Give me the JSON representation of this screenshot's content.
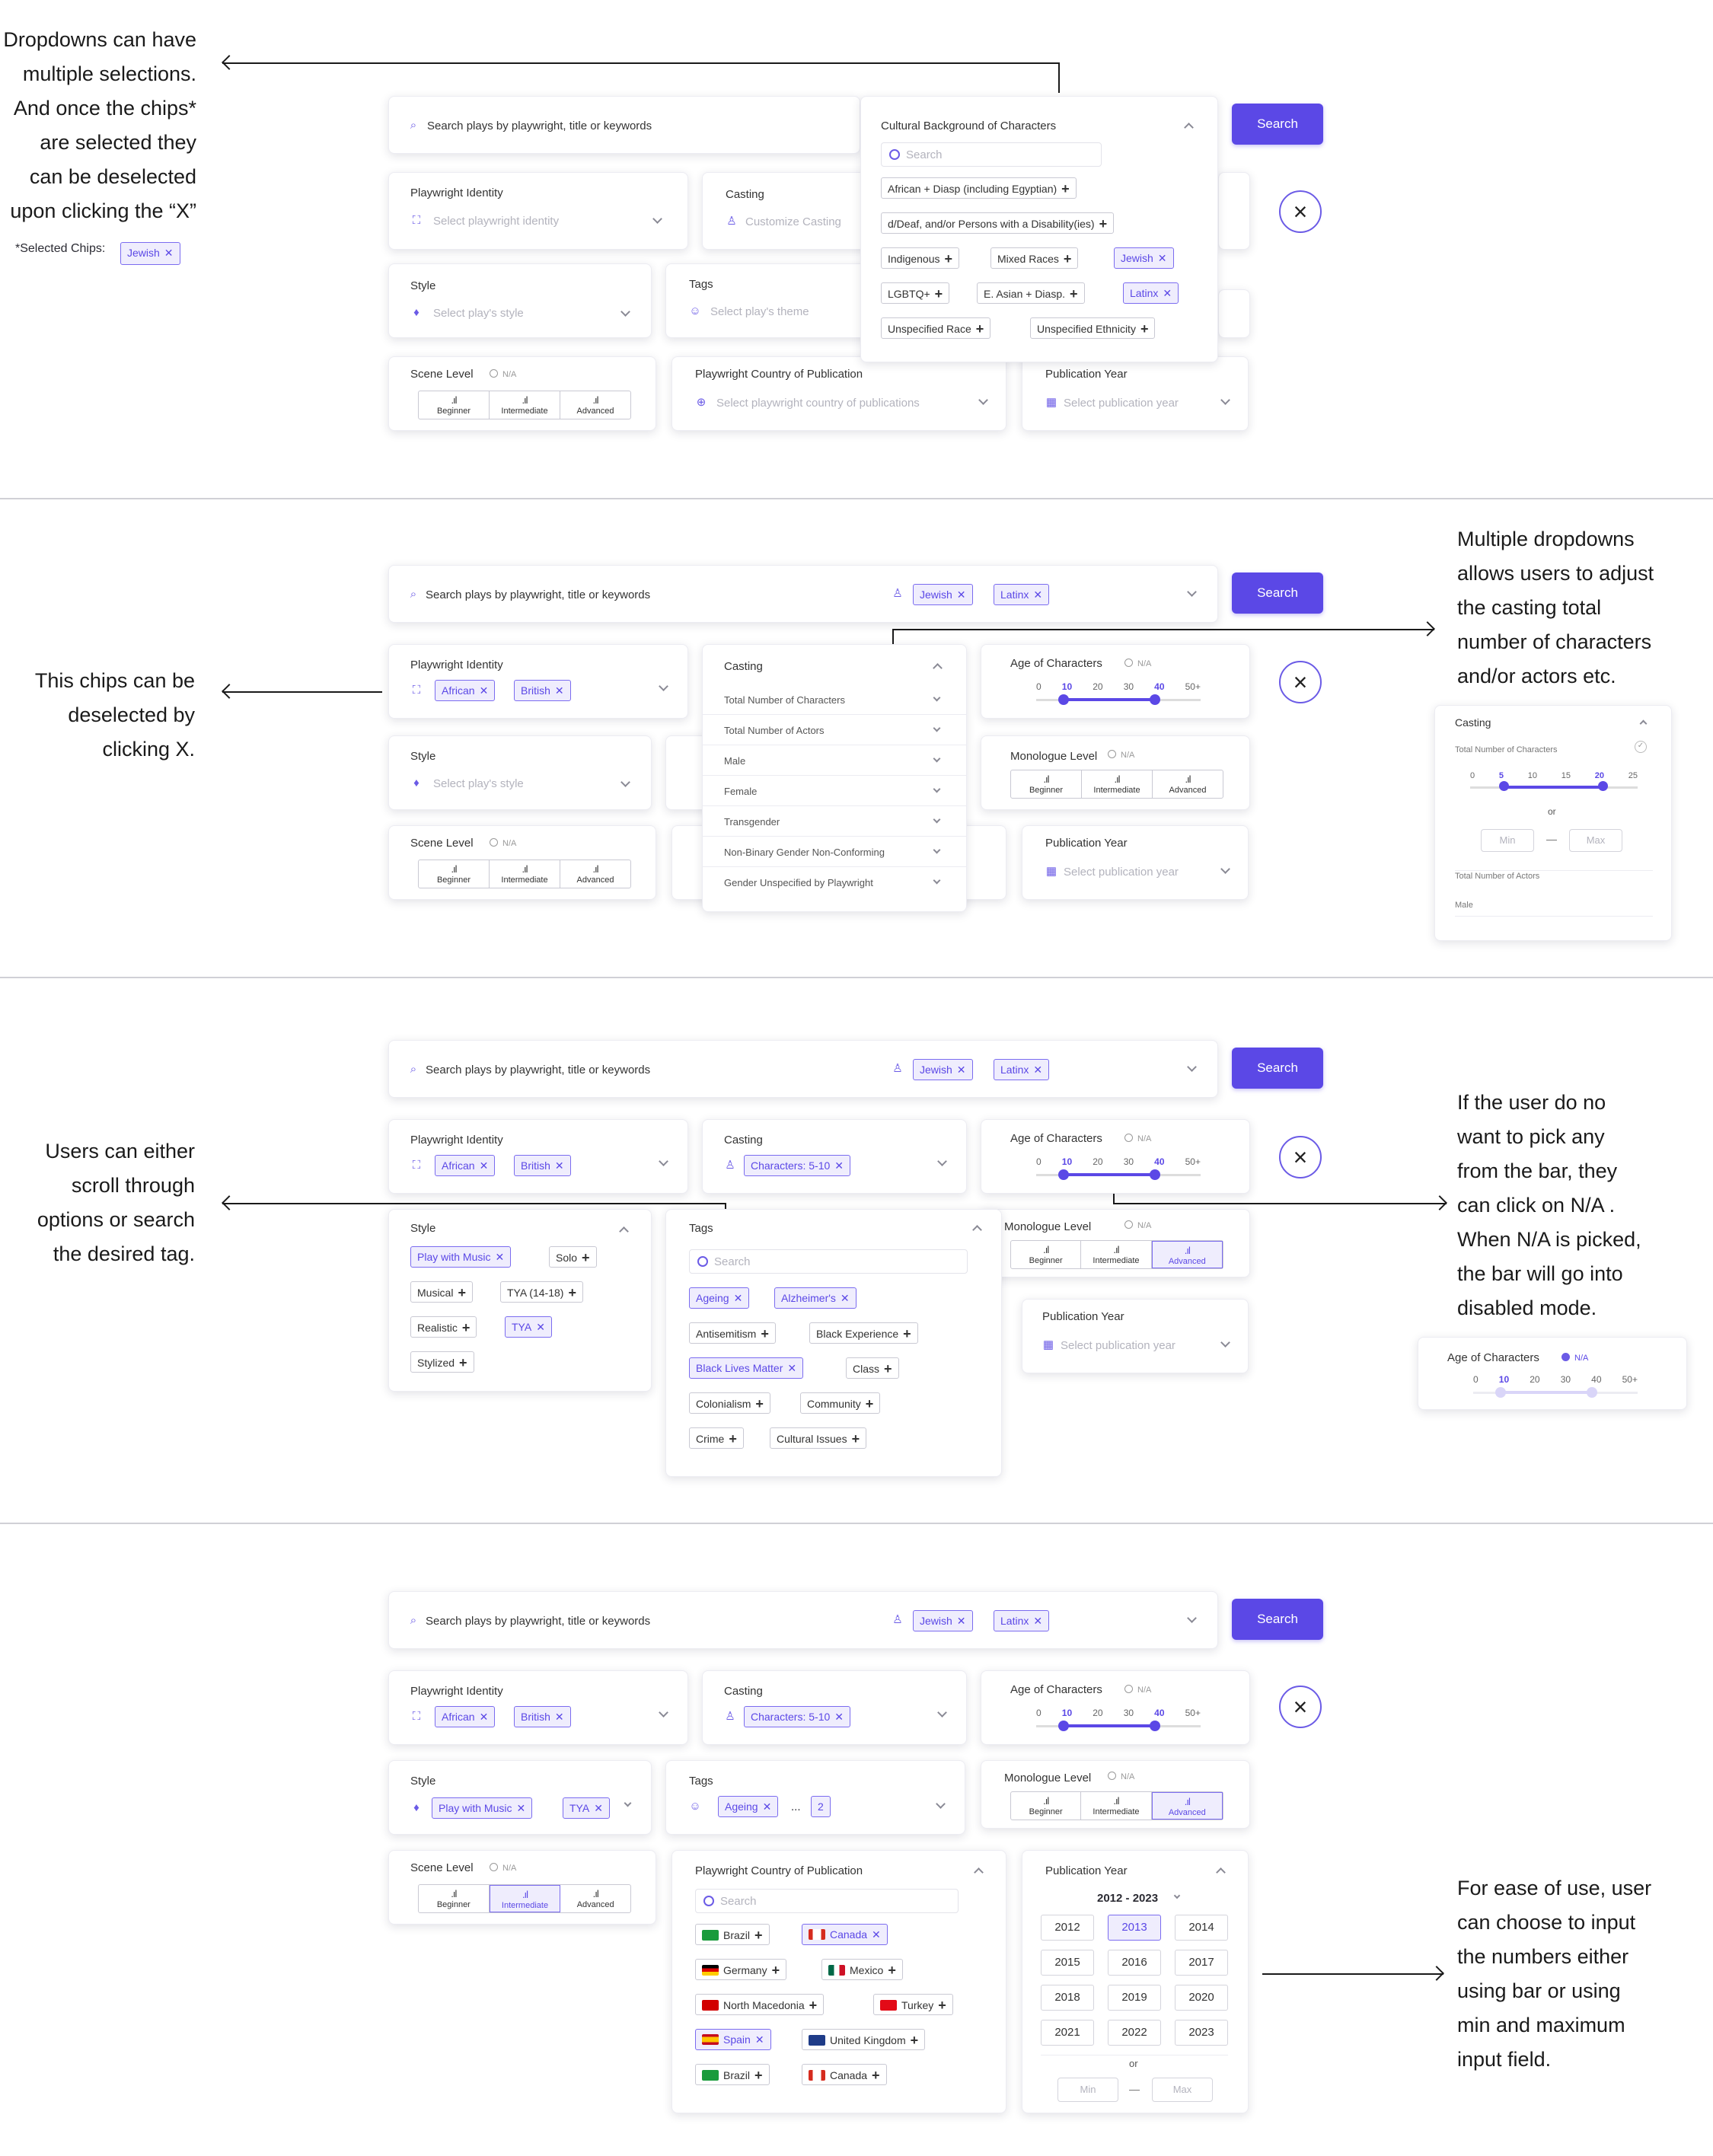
{
  "search": {
    "placeholder": "Search plays by playwright, title or keywords",
    "button": "Search"
  },
  "labels": {
    "playwright_identity": "Playwright Identity",
    "casting": "Casting",
    "style": "Style",
    "tags": "Tags",
    "scene_level": "Scene Level",
    "country": "Playwright Country of Publication",
    "pub_year": "Publication Year",
    "age": "Age of Characters",
    "monologue": "Monologue Level",
    "cultural": "Cultural Background of Characters",
    "na": "N/A",
    "or": "or",
    "min": "Min",
    "max": "Max"
  },
  "placeholders": {
    "identity": "Select playwright identity",
    "casting": "Customize Casting",
    "style": "Select play's style",
    "theme": "Select play's theme",
    "country": "Select playwright country of publications",
    "year": "Select publication year",
    "search": "Search"
  },
  "levels": [
    "Beginner",
    "Intermediate",
    "Advanced"
  ],
  "age_ticks": [
    "0",
    "10",
    "20",
    "30",
    "40",
    "50+"
  ],
  "age_range": [
    10,
    40
  ],
  "notes": {
    "n1": [
      "Dropdowns can have",
      "multiple selections.",
      "And once the chips*",
      "are selected they",
      "can be deselected",
      "upon clicking the “X”"
    ],
    "n1_small": "*Selected Chips:",
    "n2": [
      "Multiple dropdowns",
      "allows users to adjust",
      "the casting total",
      "number of characters",
      "and/or actors etc."
    ],
    "n3": [
      "This chips can be",
      "deselected by",
      "clicking X."
    ],
    "n4": [
      "Users can either",
      "scroll through",
      "options or search",
      "the desired tag."
    ],
    "n5": [
      "If the user do no",
      "want to pick any",
      "from the bar, they",
      "can click on N/A .",
      "When N/A is picked,",
      "the bar will go into",
      "disabled mode."
    ],
    "n6": [
      "For ease of use, user",
      "can choose to input",
      "the numbers either",
      "using bar or using",
      "min and maximum",
      "input field."
    ]
  },
  "chips": {
    "jewish": "Jewish",
    "latinx": "Latinx",
    "african": "African",
    "british": "British",
    "characters": "Characters: 5-10",
    "play_music": "Play with Music",
    "tya": "TYA",
    "ageing": "Ageing",
    "more": "2",
    "ellipsis": "...",
    "spain": "Spain",
    "canada": "Canada"
  },
  "cultural_options": [
    "African + Diasp (including Egyptian)",
    "d/Deaf, and/or Persons with a Disability(ies)",
    "Indigenous",
    "Mixed Races",
    "Jewish",
    "LGBTQ+",
    "E. Asian + Diasp.",
    "Latinx",
    "Unspecified Race",
    "Unspecified Ethnicity"
  ],
  "casting_options": [
    "Total Number of Characters",
    "Total Number of Actors",
    "Male",
    "Female",
    "Transgender",
    "Non-Binary Gender Non-Conforming",
    "Gender Unspecified by Playwright"
  ],
  "casting_ticks": [
    "0",
    "5",
    "10",
    "15",
    "20",
    "25"
  ],
  "style_options": [
    "Play with Music",
    "Solo",
    "Musical",
    "TYA (14-18)",
    "Realistic",
    "TYA",
    "Stylized"
  ],
  "tag_options": [
    "Ageing",
    "Alzheimer's",
    "Antisemitism",
    "Black Experience",
    "Black Lives Matter",
    "Class",
    "Colonialism",
    "Community",
    "Crime",
    "Cultural Issues"
  ],
  "countries": [
    "Brazil",
    "Canada",
    "Germany",
    "Mexico",
    "North Macedonia",
    "Turkey",
    "Spain",
    "United Kingdom",
    "Brazil",
    "Canada"
  ],
  "year_header": "2012 - 2023",
  "years": [
    "2012",
    "2013",
    "2014",
    "2015",
    "2016",
    "2017",
    "2018",
    "2019",
    "2020",
    "2021",
    "2022",
    "2023"
  ],
  "colors": {
    "accent": "#5b48e6",
    "chip_bg": "#efedfd"
  }
}
